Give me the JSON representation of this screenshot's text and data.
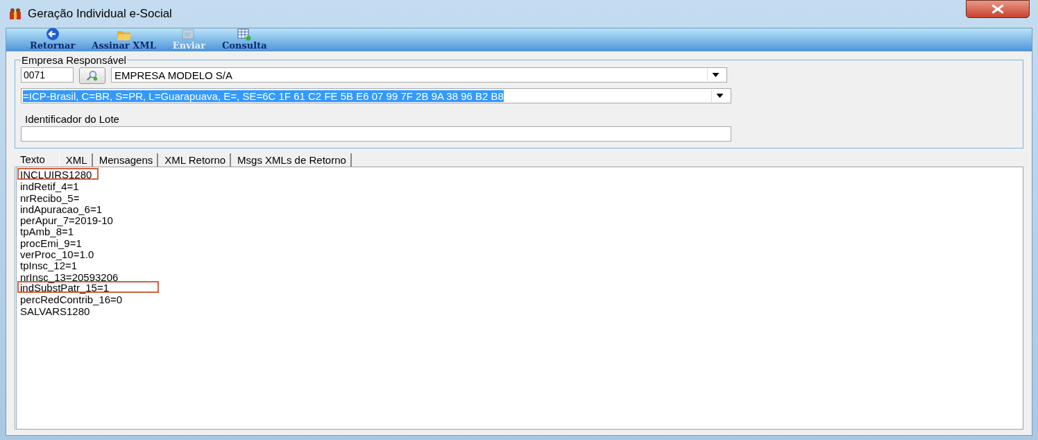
{
  "window": {
    "title": "Geração Individual e-Social"
  },
  "toolbar": [
    {
      "label": "Retornar",
      "kind": "back",
      "disabled": false
    },
    {
      "label": "Assinar XML",
      "kind": "folder",
      "disabled": false
    },
    {
      "label": "Enviar",
      "kind": "send",
      "disabled": true
    },
    {
      "label": "Consulta",
      "kind": "grid",
      "disabled": false
    }
  ],
  "group": {
    "title": "Empresa Responsável",
    "code": "0071",
    "company": "EMPRESA MODELO S/A",
    "certificate": "=ICP-Brasil, C=BR, S=PR, L=Guarapuava, E=, SE=6C 1F 61 C2 FE 5B E6 07 99 7F 2B 9A 38 96 B2 B8",
    "lot_label": "Identificador do Lote"
  },
  "tabs": [
    {
      "label": "Texto",
      "selected": true
    },
    {
      "label": "XML",
      "selected": false
    },
    {
      "label": "Mensagens",
      "selected": false
    },
    {
      "label": "XML Retorno",
      "selected": false
    },
    {
      "label": "Msgs XMLs de Retorno",
      "selected": false
    }
  ],
  "lines": [
    {
      "text": "INCLUIRS1280",
      "highlighted": true
    },
    {
      "text": "indRetif_4=1",
      "highlighted": false
    },
    {
      "text": "nrRecibo_5=",
      "highlighted": false
    },
    {
      "text": "indApuracao_6=1",
      "highlighted": false
    },
    {
      "text": "perApur_7=2019-10",
      "highlighted": false
    },
    {
      "text": "tpAmb_8=1",
      "highlighted": false
    },
    {
      "text": "procEmi_9=1",
      "highlighted": false
    },
    {
      "text": "verProc_10=1.0",
      "highlighted": false
    },
    {
      "text": "tpInsc_12=1",
      "highlighted": false
    },
    {
      "text": "nrInsc_13=20593206",
      "highlighted": false
    },
    {
      "text": "indSubstPatr_15=1",
      "highlighted": true
    },
    {
      "text": "percRedContrib_16=0",
      "highlighted": false
    },
    {
      "text": "SALVARS1280",
      "highlighted": false
    }
  ]
}
